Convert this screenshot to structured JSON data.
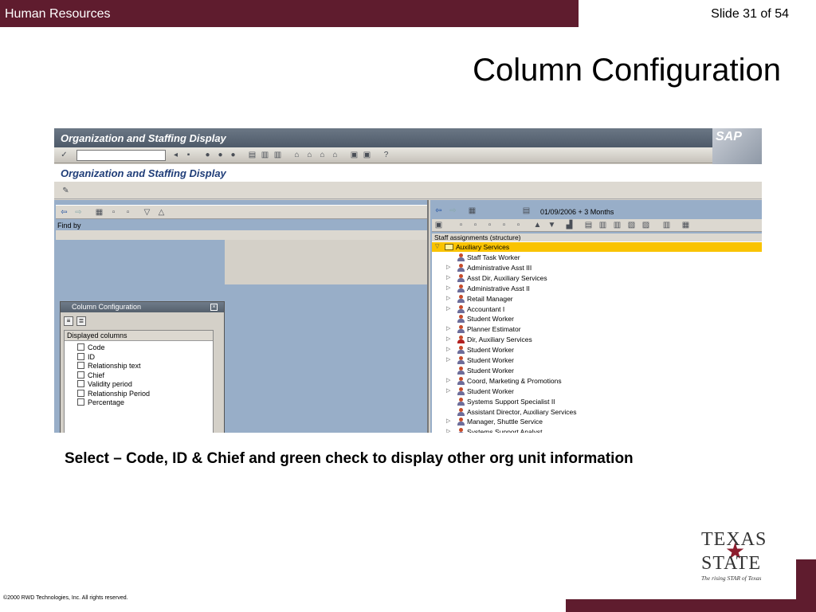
{
  "header": {
    "section": "Human Resources",
    "slide_number": "Slide 31 of 54",
    "title": "Column Configuration"
  },
  "sap": {
    "window_title": "Organization and Staffing Display",
    "logo": "SAP",
    "screen_title": "Organization and Staffing Display",
    "find_by": "Find by",
    "dialog": {
      "title": "Column Configuration",
      "list_header": "Displayed columns",
      "columns": [
        "Code",
        "ID",
        "Relationship text",
        "Chief",
        "Validity period",
        "Relationship Period",
        "Percentage"
      ],
      "ok_icon": "✔",
      "cancel_icon": "✖"
    },
    "right_pane": {
      "date_range": "01/09/2006  + 3 Months",
      "tree_header": "Staff assignments (structure)",
      "root": "Auxiliary Services",
      "items": [
        {
          "label": "Staff Task Worker",
          "expandable": false,
          "icon": "person-icon"
        },
        {
          "label": "Administrative Asst III",
          "expandable": true,
          "icon": "person-icon"
        },
        {
          "label": "Asst Dir, Auxiliary Services",
          "expandable": true,
          "icon": "person-icon"
        },
        {
          "label": "Administrative Asst II",
          "expandable": true,
          "icon": "person-icon"
        },
        {
          "label": "Retail Manager",
          "expandable": true,
          "icon": "person-icon"
        },
        {
          "label": "Accountant I",
          "expandable": true,
          "icon": "person-icon"
        },
        {
          "label": "Student Worker",
          "expandable": false,
          "icon": "person-icon"
        },
        {
          "label": "Planner Estimator",
          "expandable": true,
          "icon": "person-icon"
        },
        {
          "label": "Dir, Auxiliary Services",
          "expandable": true,
          "icon": "chief-person-icon"
        },
        {
          "label": "Student Worker",
          "expandable": true,
          "icon": "person-icon"
        },
        {
          "label": "Student Worker",
          "expandable": true,
          "icon": "person-icon"
        },
        {
          "label": "Student Worker",
          "expandable": false,
          "icon": "person-icon"
        },
        {
          "label": "Coord, Marketing & Promotions",
          "expandable": true,
          "icon": "person-icon"
        },
        {
          "label": "Student Worker",
          "expandable": true,
          "icon": "person-icon"
        },
        {
          "label": "Systems Support Specialist II",
          "expandable": false,
          "icon": "person-icon"
        },
        {
          "label": "Assistant Director, Auxiliary Services",
          "expandable": false,
          "icon": "person-icon"
        },
        {
          "label": "Manager, Shuttle Service",
          "expandable": true,
          "icon": "person-icon"
        },
        {
          "label": "Systems Support Analyst",
          "expandable": true,
          "icon": "person-icon"
        }
      ]
    }
  },
  "caption": "Select – Code, ID & Chief and green check to display other org unit information",
  "footer": {
    "copyright": "©2000 RWD Technologies, Inc.  All rights reserved."
  },
  "logo": {
    "line1": "TEXAS",
    "line2": "STATE",
    "tagline": "The rising STAR of Texas"
  },
  "colors": {
    "brand_maroon": "#5f1c2e",
    "sap_pane_blue": "#98aec8",
    "selection_yellow": "#f9c300"
  }
}
